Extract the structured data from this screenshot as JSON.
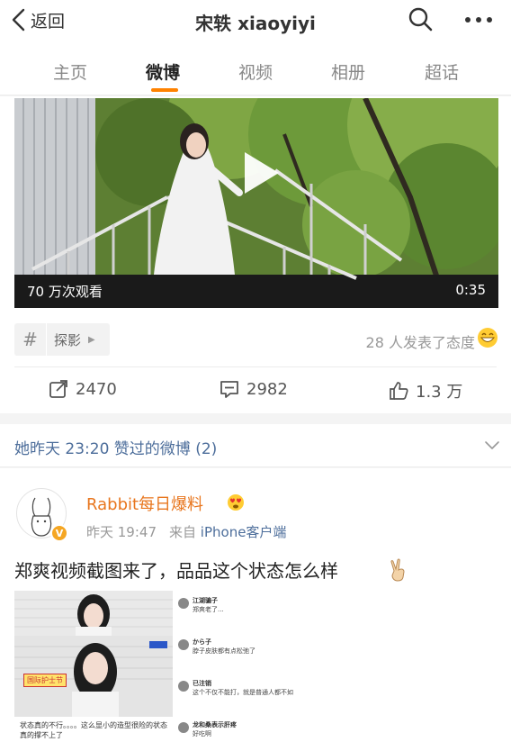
{
  "nav": {
    "back_label": "返回",
    "title": "宋轶 xiaoyiyi"
  },
  "tabs": [
    {
      "label": "主页"
    },
    {
      "label": "微博",
      "active": true
    },
    {
      "label": "视频"
    },
    {
      "label": "相册"
    },
    {
      "label": "超话"
    }
  ],
  "video": {
    "views": "70 万次观看",
    "duration": "0:35"
  },
  "topic": {
    "label": "探影"
  },
  "attitude": {
    "text": "28 人发表了态度"
  },
  "actions": {
    "repost": "2470",
    "comment": "2982",
    "like": "1.3 万"
  },
  "liked_section": {
    "text": "她昨天 23:20 赞过的微博 (2)"
  },
  "post": {
    "author": "Rabbit每日爆料",
    "time": "昨天 19:47",
    "source_prefix": "来自",
    "source": "iPhone客户端",
    "text": "郑爽视频截图来了，品品这个状态怎么样",
    "image_caption": "状态真的不行。。。。这么显小的造型很险的状态真的撑不上了",
    "image_tag": "国际护士节",
    "comments": [
      {
        "name": "江湖骗子",
        "text": "郑爽老了..."
      },
      {
        "name": "から子",
        "text": "脖子皮肤都有点松弛了"
      },
      {
        "name": "已注销",
        "text": "这个不仅不能打，就是普通人都不如"
      },
      {
        "name": "龙和桑表示肝疼",
        "text": "好吃啊"
      }
    ]
  },
  "colors": {
    "accent_orange": "#ff8200",
    "link_blue": "#4d6e9b",
    "author_orange": "#e8761e"
  }
}
